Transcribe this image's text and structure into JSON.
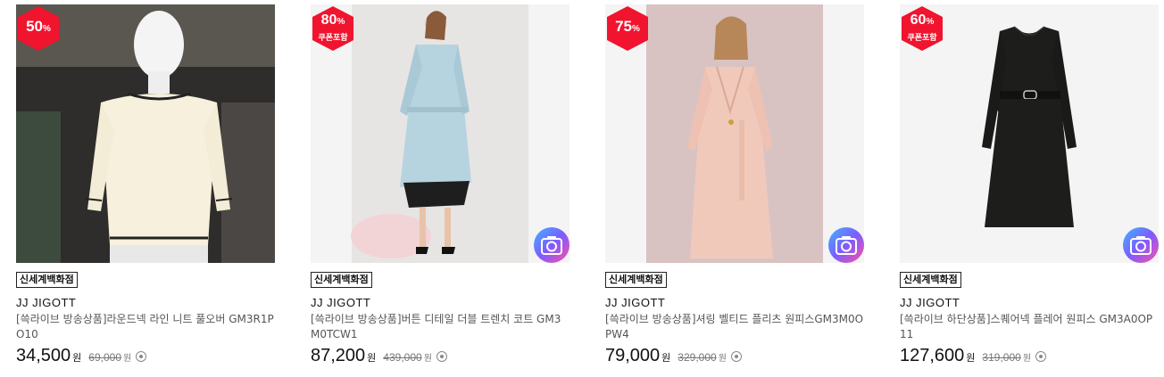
{
  "products": [
    {
      "badge": {
        "percent": "50",
        "unit": "%",
        "coupon": ""
      },
      "store": "신세계백화점",
      "brand": "JJ JIGOTT",
      "title": "[쓱라이브 방송상품]라운드넥 라인 니트 풀오버 GM3R1PO10",
      "price": "34,500",
      "won": "원",
      "original_price": "69,000",
      "original_won": "원",
      "has_camera": false
    },
    {
      "badge": {
        "percent": "80",
        "unit": "%",
        "coupon": "쿠폰포함"
      },
      "store": "신세계백화점",
      "brand": "JJ JIGOTT",
      "title": "[쓱라이브 방송상품]버튼 디테일 더블 트렌치 코트 GM3M0TCW1",
      "price": "87,200",
      "won": "원",
      "original_price": "439,000",
      "original_won": "원",
      "has_camera": true
    },
    {
      "badge": {
        "percent": "75",
        "unit": "%",
        "coupon": ""
      },
      "store": "신세계백화점",
      "brand": "JJ JIGOTT",
      "title": "[쓱라이브 방송상품]셔링 벨티드 플리츠 원피스GM3M0OPW4",
      "price": "79,000",
      "won": "원",
      "original_price": "329,000",
      "original_won": "원",
      "has_camera": true
    },
    {
      "badge": {
        "percent": "60",
        "unit": "%",
        "coupon": "쿠폰포함"
      },
      "store": "신세계백화점",
      "brand": "JJ JIGOTT",
      "title": "[쓱라이브 하단상품]스퀘어넥 플레어 원피스 GM3A0OP11",
      "price": "127,600",
      "won": "원",
      "original_price": "319,000",
      "original_won": "원",
      "has_camera": true
    }
  ],
  "colors": {
    "badge_red": "#f0142f",
    "price": "#111111",
    "original_price": "#777777"
  },
  "icons": {
    "camera": "camera-icon",
    "info": "info-circle-icon"
  }
}
